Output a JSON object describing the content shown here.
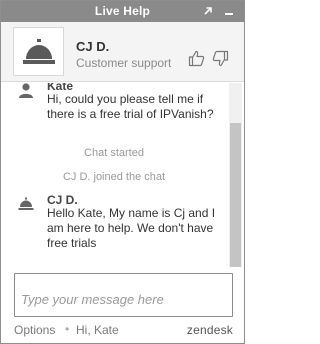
{
  "titlebar": {
    "title": "Live Help",
    "icons": [
      "popout-icon",
      "minimize-icon"
    ]
  },
  "agent": {
    "name": "CJ D.",
    "role": "Customer support",
    "avatar_icon": "service-bell-icon",
    "rating_icons": [
      "thumbs-up-icon",
      "thumbs-down-icon"
    ]
  },
  "chat": {
    "messages": [
      {
        "author": "Kate",
        "text": "Hi, could you please tell me if there is a free trial of IPVanish?",
        "icon": "user-icon"
      },
      {
        "author": "CJ D.",
        "text": "Hello Kate, My name is Cj and I am here to help. We don't have free trials",
        "icon": "service-bell-icon"
      }
    ],
    "system": [
      "Chat started",
      "CJ D. joined the chat"
    ]
  },
  "input": {
    "placeholder": "Type your message here",
    "value": ""
  },
  "footer": {
    "options": "Options",
    "separator": "•",
    "greeting": "Hi, Kate",
    "brand": "zendesk"
  },
  "colors": {
    "titlebar": "#8a8a8a",
    "header_bg": "#f4f4f4",
    "text": "#333333",
    "muted": "#9a9a9a"
  }
}
